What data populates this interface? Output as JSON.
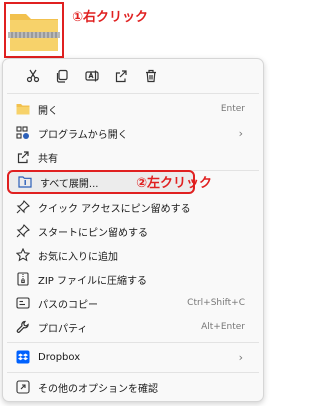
{
  "annotations": {
    "step1": "①右クリック",
    "step2": "②左クリック"
  },
  "colors": {
    "annotation_red": "#e02020",
    "menu_bg": "#f9f9f9",
    "icon_blue": "#2b5fb8",
    "dropbox_blue": "#0061fe",
    "folder_yellow": "#f2c14e"
  },
  "toolbar": [
    {
      "icon": "cut-icon"
    },
    {
      "icon": "copy-icon"
    },
    {
      "icon": "rename-icon"
    },
    {
      "icon": "share-icon"
    },
    {
      "icon": "delete-icon"
    }
  ],
  "menu": {
    "items": [
      {
        "icon": "folder-open-icon",
        "label": "開く",
        "shortcut": "Enter"
      },
      {
        "icon": "open-with-icon",
        "label": "プログラムから開く",
        "submenu": true
      },
      {
        "icon": "share-icon",
        "label": "共有"
      },
      {
        "icon": "extract-all-icon",
        "label": "すべて展開...",
        "highlighted": true
      },
      {
        "icon": "pin-icon",
        "label": "クイック アクセスにピン留めする"
      },
      {
        "icon": "pin-icon",
        "label": "スタートにピン留めする"
      },
      {
        "icon": "star-icon",
        "label": "お気に入りに追加"
      },
      {
        "icon": "zip-icon",
        "label": "ZIP ファイルに圧縮する"
      },
      {
        "icon": "copy-path-icon",
        "label": "パスのコピー",
        "shortcut": "Ctrl+Shift+C"
      },
      {
        "icon": "wrench-icon",
        "label": "プロパティ",
        "shortcut": "Alt+Enter"
      },
      {
        "icon": "dropbox-icon",
        "label": "Dropbox",
        "submenu": true
      },
      {
        "icon": "more-options-icon",
        "label": "その他のオプションを確認"
      }
    ]
  }
}
